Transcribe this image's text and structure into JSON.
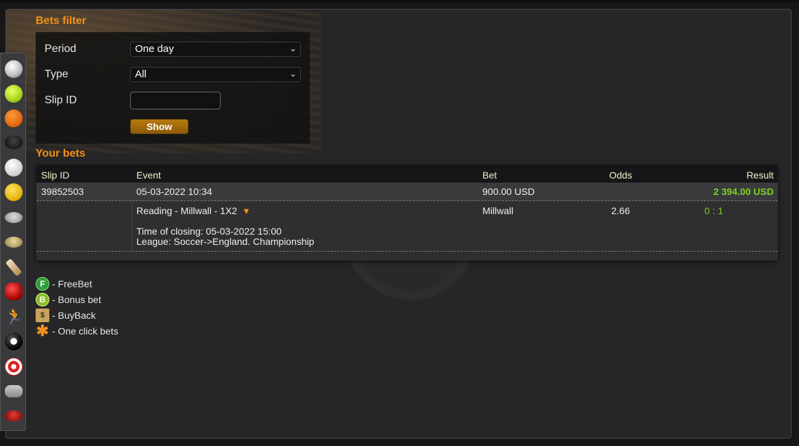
{
  "filter": {
    "title": "Bets filter",
    "period_label": "Period",
    "period_value": "One day",
    "type_label": "Type",
    "type_value": "All",
    "slip_label": "Slip ID",
    "slip_value": "",
    "show_button": "Show"
  },
  "bets": {
    "title": "Your bets",
    "columns": {
      "slip_id": "Slip ID",
      "event": "Event",
      "bet": "Bet",
      "odds": "Odds",
      "result": "Result"
    },
    "rows": [
      {
        "slip_id": "39852503",
        "date": "05-03-2022 10:34",
        "amount": "900.00 USD",
        "result": "2 394.00 USD",
        "event_name": "Reading - Millwall - 1X2",
        "selection": "Millwall",
        "odds": "2.66",
        "score": "0 : 1",
        "closing": "Time of closing: 05-03-2022 15:00",
        "league": "League: Soccer->England. Championship"
      }
    ]
  },
  "legend": [
    {
      "icon": "freebet-icon",
      "text": "- FreeBet"
    },
    {
      "icon": "bonus-bet-icon",
      "text": "- Bonus bet"
    },
    {
      "icon": "buyback-icon",
      "text": "- BuyBack"
    },
    {
      "icon": "one-click-icon",
      "text": "- One click bets"
    }
  ],
  "sports": [
    "soccer-icon",
    "tennis-icon",
    "basketball-icon",
    "hockey-puck-icon",
    "volleyball-icon",
    "handball-icon",
    "american-football-icon",
    "rugby-icon",
    "cricket-icon",
    "boxing-icon",
    "athletics-icon",
    "billiards-icon",
    "darts-icon",
    "esports-icon",
    "aussie-rules-icon"
  ],
  "colors": {
    "accent": "#f39019",
    "result_green": "#7ed321",
    "header_text": "#f2f2c8"
  }
}
